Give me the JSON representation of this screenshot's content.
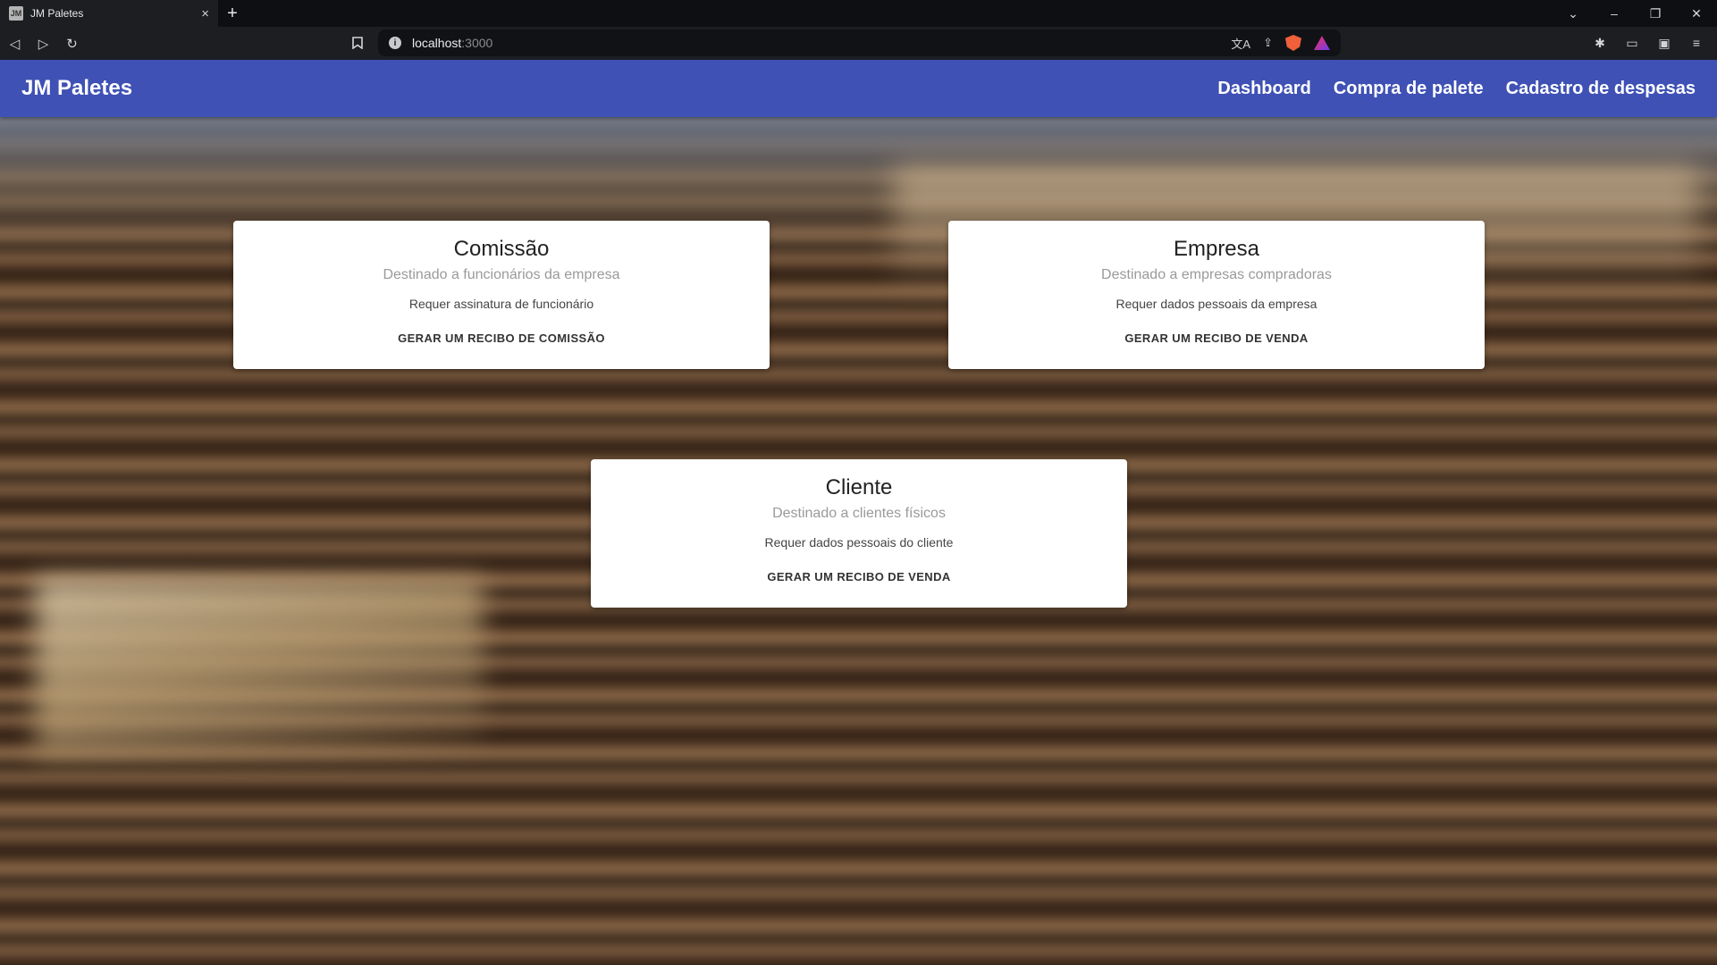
{
  "browser": {
    "tab": {
      "favicon_text": "JM",
      "title": "JM Paletes",
      "close": "×"
    },
    "new_tab": "+",
    "window_controls": {
      "list": "⌄",
      "minimize": "–",
      "restore": "❐",
      "close": "✕"
    },
    "nav": {
      "back": "◁",
      "forward": "▷",
      "reload": "↻",
      "bookmark": "🔖"
    },
    "url": {
      "host": "localhost",
      "port": ":3000"
    },
    "url_icons": {
      "translate": "文A",
      "share": "⇪"
    },
    "toolbar_icons": {
      "extensions": "✱",
      "sidebar": "▭",
      "wallet": "▣",
      "menu": "≡"
    }
  },
  "app": {
    "brand": "JM Paletes",
    "nav": [
      "Dashboard",
      "Compra de palete",
      "Cadastro de despesas"
    ],
    "colors": {
      "appbar": "#3f51b5",
      "card": "#ffffff"
    }
  },
  "cards": [
    {
      "title": "Comissão",
      "subtitle": "Destinado a funcionários da empresa",
      "description": "Requer assinatura de funcionário",
      "action": "GERAR UM RECIBO DE COMISSÃO"
    },
    {
      "title": "Empresa",
      "subtitle": "Destinado a empresas compradoras",
      "description": "Requer dados pessoais da empresa",
      "action": "GERAR UM RECIBO DE VENDA"
    },
    {
      "title": "Cliente",
      "subtitle": "Destinado a clientes físicos",
      "description": "Requer dados pessoais do cliente",
      "action": "GERAR UM RECIBO DE VENDA"
    }
  ]
}
